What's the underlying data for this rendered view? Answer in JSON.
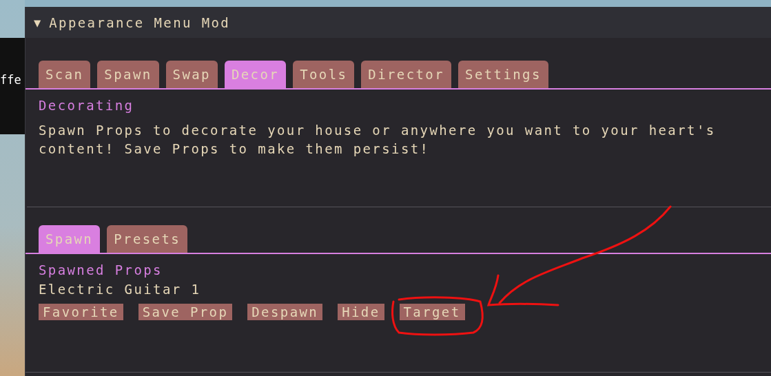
{
  "background_text": "ffe",
  "window": {
    "collapse_glyph": "▼",
    "title": "Appearance Menu Mod"
  },
  "tabs": [
    {
      "label": "Scan",
      "selected": false
    },
    {
      "label": "Spawn",
      "selected": false
    },
    {
      "label": "Swap",
      "selected": false
    },
    {
      "label": "Decor",
      "selected": true
    },
    {
      "label": "Tools",
      "selected": false
    },
    {
      "label": "Director",
      "selected": false
    },
    {
      "label": "Settings",
      "selected": false
    }
  ],
  "section": {
    "heading": "Decorating",
    "description": "Spawn Props to decorate your house or anywhere you want to your heart's content! Save Props to make them persist!"
  },
  "subtabs": [
    {
      "label": "Spawn",
      "selected": true
    },
    {
      "label": "Presets",
      "selected": false
    }
  ],
  "spawned": {
    "heading": "Spawned Props",
    "item": "Electric Guitar 1",
    "buttons": [
      "Favorite",
      "Save Prop",
      "Despawn",
      "Hide",
      "Target"
    ]
  }
}
